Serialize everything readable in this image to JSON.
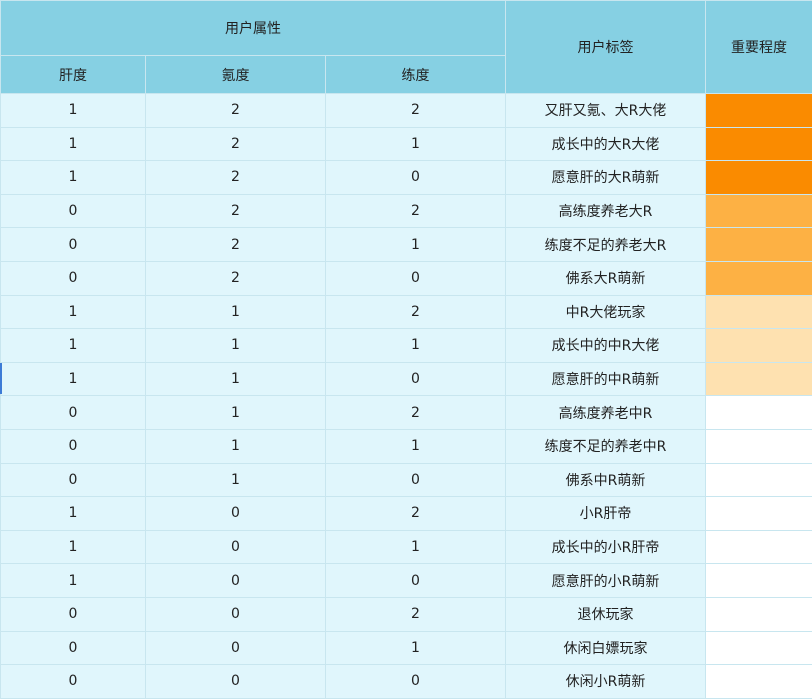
{
  "headers": {
    "group": "用户属性",
    "attr1": "肝度",
    "attr2": "氪度",
    "attr3": "练度",
    "tag": "用户标签",
    "importance": "重要程度"
  },
  "importance_colors": {
    "hi": "#fa8b00",
    "mid": "#fdb144",
    "lo": "#fee1b0",
    "none": "#ffffff"
  },
  "rows": [
    {
      "gan": "1",
      "ke": "2",
      "lian": "2",
      "tag": "又肝又氪、大R大佬",
      "level": "hi"
    },
    {
      "gan": "1",
      "ke": "2",
      "lian": "1",
      "tag": "成长中的大R大佬",
      "level": "hi"
    },
    {
      "gan": "1",
      "ke": "2",
      "lian": "0",
      "tag": "愿意肝的大R萌新",
      "level": "hi"
    },
    {
      "gan": "0",
      "ke": "2",
      "lian": "2",
      "tag": "高练度养老大R",
      "level": "mid"
    },
    {
      "gan": "0",
      "ke": "2",
      "lian": "1",
      "tag": "练度不足的养老大R",
      "level": "mid"
    },
    {
      "gan": "0",
      "ke": "2",
      "lian": "0",
      "tag": "佛系大R萌新",
      "level": "mid"
    },
    {
      "gan": "1",
      "ke": "1",
      "lian": "2",
      "tag": "中R大佬玩家",
      "level": "lo"
    },
    {
      "gan": "1",
      "ke": "1",
      "lian": "1",
      "tag": "成长中的中R大佬",
      "level": "lo"
    },
    {
      "gan": "1",
      "ke": "1",
      "lian": "0",
      "tag": "愿意肝的中R萌新",
      "level": "lo"
    },
    {
      "gan": "0",
      "ke": "1",
      "lian": "2",
      "tag": "高练度养老中R",
      "level": "none"
    },
    {
      "gan": "0",
      "ke": "1",
      "lian": "1",
      "tag": "练度不足的养老中R",
      "level": "none"
    },
    {
      "gan": "0",
      "ke": "1",
      "lian": "0",
      "tag": "佛系中R萌新",
      "level": "none"
    },
    {
      "gan": "1",
      "ke": "0",
      "lian": "2",
      "tag": "小R肝帝",
      "level": "none"
    },
    {
      "gan": "1",
      "ke": "0",
      "lian": "1",
      "tag": "成长中的小R肝帝",
      "level": "none"
    },
    {
      "gan": "1",
      "ke": "0",
      "lian": "0",
      "tag": "愿意肝的小R萌新",
      "level": "none"
    },
    {
      "gan": "0",
      "ke": "0",
      "lian": "2",
      "tag": "退休玩家",
      "level": "none"
    },
    {
      "gan": "0",
      "ke": "0",
      "lian": "1",
      "tag": "休闲白嫖玩家",
      "level": "none"
    },
    {
      "gan": "0",
      "ke": "0",
      "lian": "0",
      "tag": "休闲小R萌新",
      "level": "none"
    }
  ]
}
